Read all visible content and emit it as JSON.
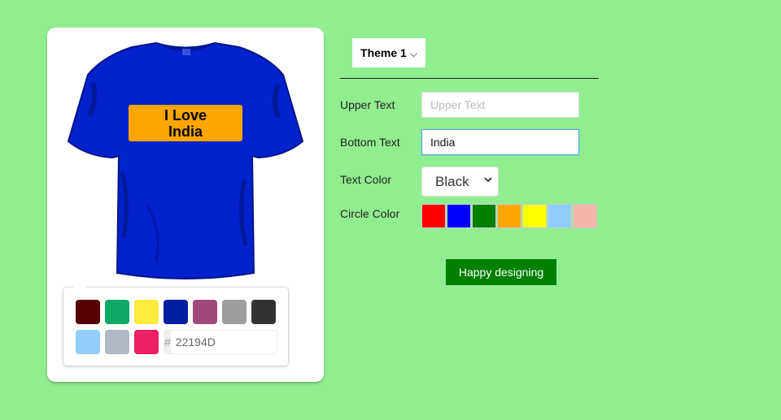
{
  "preview": {
    "shirt_color": "#0022cc",
    "label_color": "#ffa500",
    "upper_line": "I Love",
    "bottom_line": "India"
  },
  "picker": {
    "swatches": [
      "#560000",
      "#0daa67",
      "#ffeb3b",
      "#001ea0",
      "#a2497a",
      "#9e9e9e",
      "#333333",
      "#90cdfa",
      "#b0b8c4",
      "#ec1e64"
    ],
    "hash": "#",
    "hex_value": "22194D"
  },
  "theme": {
    "label": "Theme 1",
    "chevron": "⌵"
  },
  "form": {
    "upper_label": "Upper Text",
    "upper_placeholder": "Upper Text",
    "upper_value": "",
    "bottom_label": "Bottom Text",
    "bottom_value": "India",
    "text_color_label": "Text Color",
    "text_color_selected": "Black",
    "circle_color_label": "Circle Color",
    "circle_colors": [
      "#ff0000",
      "#0000ff",
      "#008000",
      "#ffa500",
      "#ffff00",
      "#90cdfa",
      "#f4b4a8"
    ]
  },
  "submit_label": "Happy designing"
}
